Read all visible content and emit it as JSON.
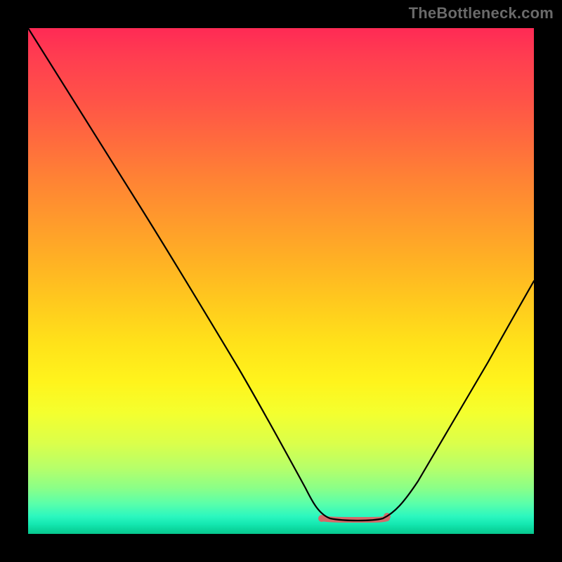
{
  "attribution": "TheBottleneck.com",
  "colors": {
    "page_bg": "#000000",
    "curve": "#000000",
    "flat_accent": "#d46a6a",
    "gradient_top": "#ff2a55",
    "gradient_mid": "#ffe11a",
    "gradient_bottom": "#08c78e"
  },
  "chart_data": {
    "type": "line",
    "title": "",
    "xlabel": "",
    "ylabel": "",
    "xlim": [
      0,
      100
    ],
    "ylim": [
      0,
      100
    ],
    "grid": false,
    "legend": false,
    "series": [
      {
        "name": "bottleneck-curve",
        "x": [
          0,
          5,
          10,
          15,
          20,
          25,
          30,
          35,
          40,
          45,
          50,
          55,
          58,
          60,
          62,
          65,
          68,
          71,
          75,
          80,
          85,
          90,
          95,
          100
        ],
        "values": [
          100,
          92,
          84,
          76,
          68,
          60,
          52,
          44,
          36,
          28,
          20,
          12,
          7,
          4,
          3,
          3,
          3,
          4,
          7,
          13,
          20,
          28,
          37,
          46
        ]
      }
    ],
    "annotations": [
      {
        "kind": "flat-minimum-highlight",
        "x_start": 58,
        "x_end": 71,
        "y": 3
      }
    ]
  }
}
